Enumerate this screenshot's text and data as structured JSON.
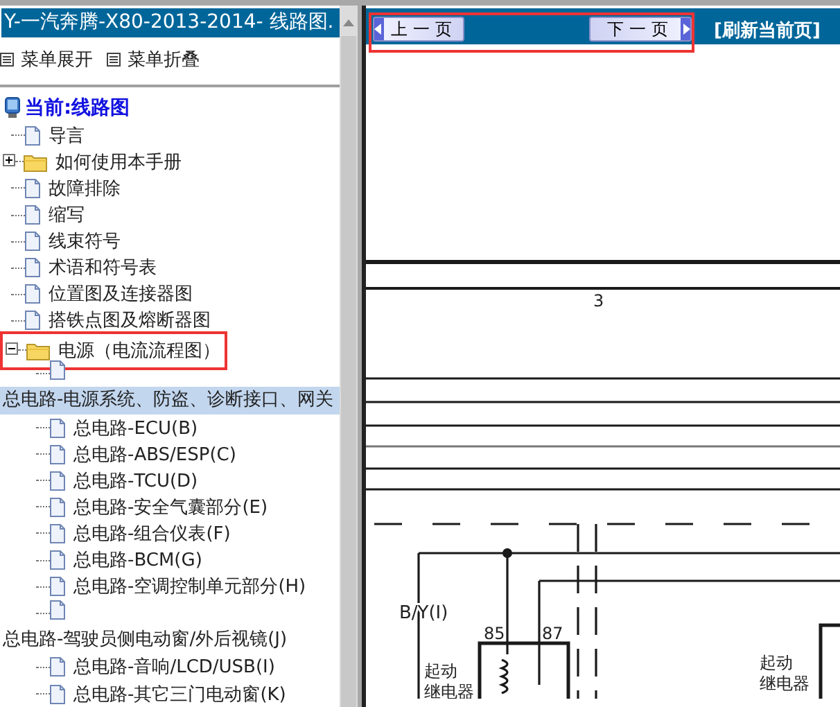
{
  "sidebar": {
    "title": "Y-一汽奔腾-X80-2013-2014- 线路图.",
    "menu": [
      {
        "label": "菜单展开"
      },
      {
        "label": "菜单折叠"
      }
    ],
    "tree": {
      "label": "当前:线路图",
      "children": [
        {
          "kind": "doc",
          "label": "导言"
        },
        {
          "kind": "folder",
          "label": "如何使用本手册",
          "expanded": false
        },
        {
          "kind": "doc",
          "label": "故障排除"
        },
        {
          "kind": "doc",
          "label": "缩写"
        },
        {
          "kind": "doc",
          "label": "线束符号"
        },
        {
          "kind": "doc",
          "label": "术语和符号表"
        },
        {
          "kind": "doc",
          "label": "位置图及连接器图"
        },
        {
          "kind": "doc",
          "label": "搭铁点图及熔断器图"
        },
        {
          "kind": "folder",
          "label": "电源（电流流程图）",
          "expanded": true,
          "highlighted": true,
          "children": [
            {
              "kind": "wrapped",
              "label": "总电路-电源系统、防盗、诊断接口、网关",
              "selected": true
            },
            {
              "kind": "doc",
              "label": "总电路-ECU(B)",
              "selected": false
            },
            {
              "kind": "doc",
              "label": "总电路-ABS/ESP(C)",
              "selected": false
            },
            {
              "kind": "doc",
              "label": "总电路-TCU(D)",
              "selected": false
            },
            {
              "kind": "doc",
              "label": "总电路-安全气囊部分(E)",
              "selected": false
            },
            {
              "kind": "doc",
              "label": "总电路-组合仪表(F)",
              "selected": false
            },
            {
              "kind": "doc",
              "label": "总电路-BCM(G)",
              "selected": false
            },
            {
              "kind": "doc",
              "label": "总电路-空调控制单元部分(H)",
              "selected": false
            },
            {
              "kind": "wrapped",
              "label": "总电路-驾驶员侧电动窗/外后视镜(J)",
              "selected": false
            },
            {
              "kind": "doc",
              "label": "总电路-音响/LCD/USB(I)",
              "selected": false
            },
            {
              "kind": "doc",
              "label": "总电路-其它三门电动窗(K)",
              "selected": false
            }
          ]
        }
      ]
    }
  },
  "content": {
    "nav": {
      "highlighted": true,
      "previous": "上一页",
      "next": "下一页",
      "refresh": "[刷新当前页]"
    },
    "diagram": {
      "page_number": "3",
      "wire_label": "B/Y(I)",
      "pins": [
        "85",
        "87"
      ],
      "relays": [
        {
          "line1": "起动",
          "line2": "继电器"
        },
        {
          "line1": "起动",
          "line2": "继电器"
        }
      ]
    }
  }
}
